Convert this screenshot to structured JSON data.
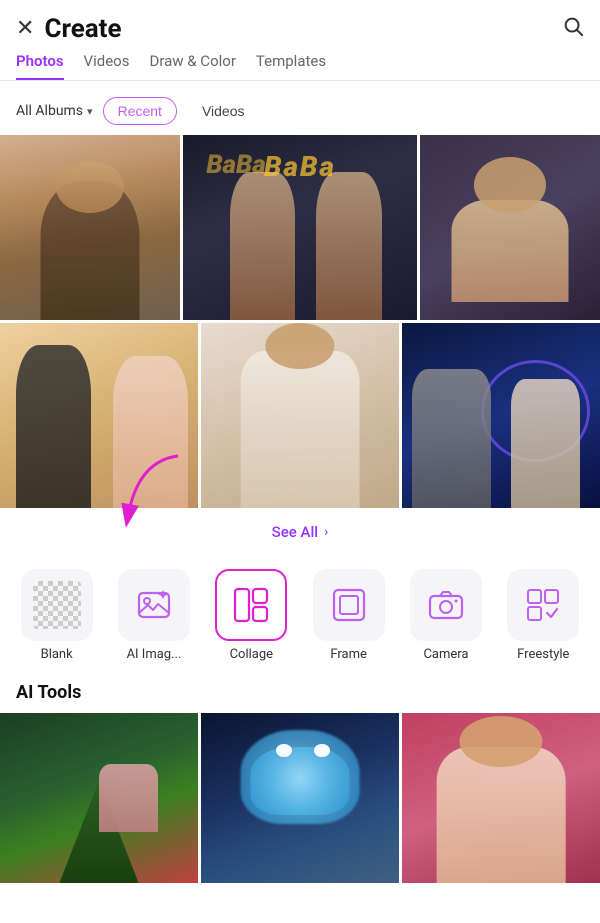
{
  "header": {
    "title": "Create",
    "close_icon": "✕",
    "search_icon": "🔍"
  },
  "nav": {
    "tabs": [
      {
        "label": "Photos",
        "active": true
      },
      {
        "label": "Videos",
        "active": false
      },
      {
        "label": "Draw & Color",
        "active": false
      },
      {
        "label": "Templates",
        "active": false
      }
    ]
  },
  "filter": {
    "albums_label": "All Albums",
    "recent_label": "Recent",
    "videos_label": "Videos"
  },
  "photos": {
    "see_all_label": "See All",
    "rows": [
      [
        {
          "id": "p1",
          "color": "photo-p1",
          "desc": "man portrait"
        },
        {
          "id": "p2",
          "color": "photo-p2",
          "desc": "two women"
        },
        {
          "id": "p3",
          "color": "photo-p3",
          "desc": "young man lying"
        }
      ],
      [
        {
          "id": "p4",
          "color": "photo-p4",
          "desc": "two women standing"
        },
        {
          "id": "p5",
          "color": "photo-p5",
          "desc": "man in white shirt"
        },
        {
          "id": "p6",
          "color": "photo-p6",
          "desc": "couple neon lights"
        }
      ]
    ]
  },
  "create_options": [
    {
      "id": "blank",
      "label": "Blank",
      "icon": "blank"
    },
    {
      "id": "ai_image",
      "label": "AI Imag...",
      "icon": "image"
    },
    {
      "id": "collage",
      "label": "Collage",
      "icon": "collage",
      "highlighted": true
    },
    {
      "id": "frame",
      "label": "Frame",
      "icon": "frame"
    },
    {
      "id": "camera",
      "label": "Camera",
      "icon": "camera"
    },
    {
      "id": "freestyle",
      "label": "Freestyle",
      "icon": "freestyle"
    }
  ],
  "ai_tools": {
    "title": "AI Tools",
    "items": [
      {
        "id": "ai1",
        "color": "ai-p1",
        "desc": "christmas scene"
      },
      {
        "id": "ai2",
        "color": "ai-p2",
        "desc": "fantasy creature"
      },
      {
        "id": "ai3",
        "color": "ai-p3",
        "desc": "woman portrait"
      }
    ]
  }
}
